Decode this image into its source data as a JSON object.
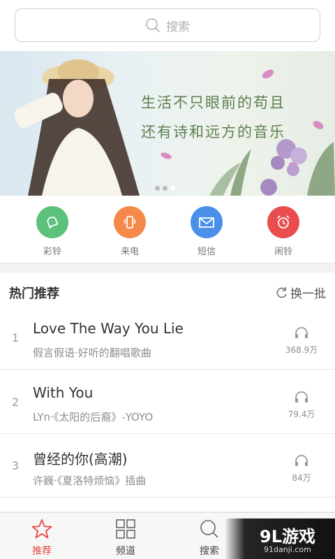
{
  "search": {
    "placeholder": "搜索"
  },
  "banner": {
    "line1": "生活不只眼前的苟且",
    "line2": "还有诗和远方的音乐",
    "slide_count": 3,
    "active_slide": 3
  },
  "quick_links": [
    {
      "label": "彩铃",
      "icon": "bell-icon",
      "color": "#5cc27b"
    },
    {
      "label": "来电",
      "icon": "phone-vibrate-icon",
      "color": "#f5894a"
    },
    {
      "label": "短信",
      "icon": "envelope-icon",
      "color": "#4a90e8"
    },
    {
      "label": "闹铃",
      "icon": "alarm-clock-icon",
      "color": "#ea4d4d"
    }
  ],
  "hot": {
    "title": "热门推荐",
    "refresh_label": "换一批",
    "items": [
      {
        "rank": "1",
        "title": "Love The Way You Lie",
        "subtitle": "假言假语·好听的翻唱歌曲",
        "plays": "368.9万"
      },
      {
        "rank": "2",
        "title": "With You",
        "subtitle": "LYn·《太阳的后裔》-YOYO",
        "plays": "79.4万"
      },
      {
        "rank": "3",
        "title": "曾经的你(高潮)",
        "subtitle": "许巍·《夏洛特烦恼》插曲",
        "plays": "84万"
      }
    ]
  },
  "tabbar": {
    "tabs": [
      {
        "label": "推荐",
        "icon": "star-icon",
        "active": true
      },
      {
        "label": "频道",
        "icon": "grid-icon",
        "active": false
      },
      {
        "label": "搜索",
        "icon": "search-icon",
        "active": false
      }
    ]
  },
  "watermark": {
    "logo_text": "9L游戏",
    "site": "91danji.com"
  },
  "colors": {
    "accent": "#e64545",
    "text_primary": "#333333",
    "text_secondary": "#8e8e8e"
  }
}
